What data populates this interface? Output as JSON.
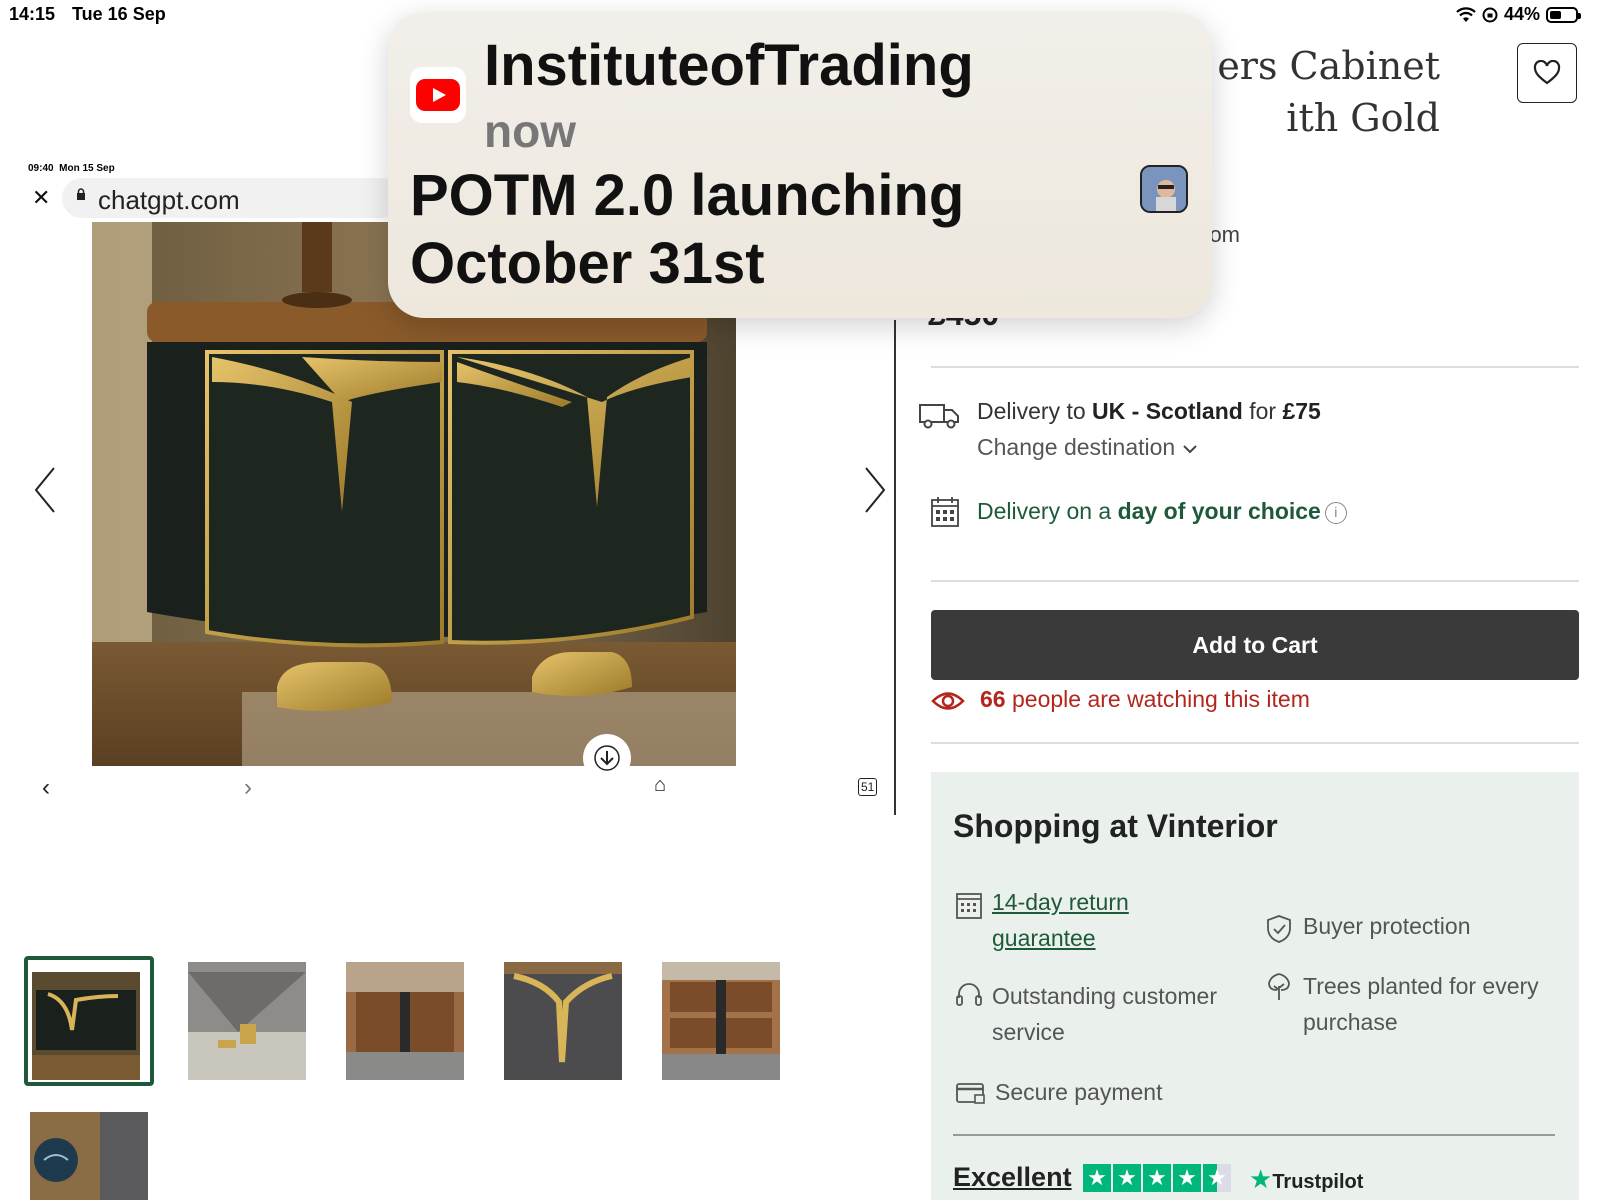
{
  "status_bar": {
    "time": "14:15",
    "date": "Tue 16 Sep",
    "battery": "44%",
    "battery_level": 0.44
  },
  "product": {
    "title_fragment_1": "ers Cabinet",
    "title_fragment_2": "ith Gold",
    "seller_fragment": "om",
    "price_fragment": "£450"
  },
  "embedded_screenshot": {
    "status_time": "09:40",
    "status_date": "Mon 15 Sep",
    "close_label": "✕",
    "url": "chatgpt.com",
    "tabs_count": "51"
  },
  "delivery": {
    "prefix": "Delivery to ",
    "region": "UK - Scotland",
    "middle": " for ",
    "cost": "£75",
    "change_destination": "Change destination",
    "day_prefix": "Delivery on a ",
    "day_emphasis": "day of your choice"
  },
  "cart": {
    "add_to_cart": "Add to Cart",
    "watch_count": "66",
    "watch_text": " people are watching this item"
  },
  "vinterior": {
    "title": "Shopping at Vinterior",
    "return_line1": "14-day return",
    "return_line2": "guarantee",
    "buyer_protection": "Buyer protection",
    "customer_service_line1": "Outstanding customer",
    "customer_service_line2": "service",
    "trees_line1": "Trees planted for every",
    "trees_line2": "purchase",
    "secure_payment": "Secure payment",
    "rating_label": "Excellent",
    "rating_stars": 4.5,
    "trustpilot": "Trustpilot"
  },
  "notification": {
    "app": "youtube-icon",
    "sender": "InstituteofTrading",
    "time": "now",
    "body_line1": "POTM 2.0 launching",
    "body_line2": "October 31st"
  },
  "thumbnails": {
    "count": 6,
    "selected_index": 0
  },
  "colors": {
    "brand_green": "#1e5a3a",
    "watch_red": "#b3261e",
    "cart_button": "#3a3a3a",
    "panel_bg": "#eaf1ec",
    "trustpilot_green": "#00b67a"
  }
}
